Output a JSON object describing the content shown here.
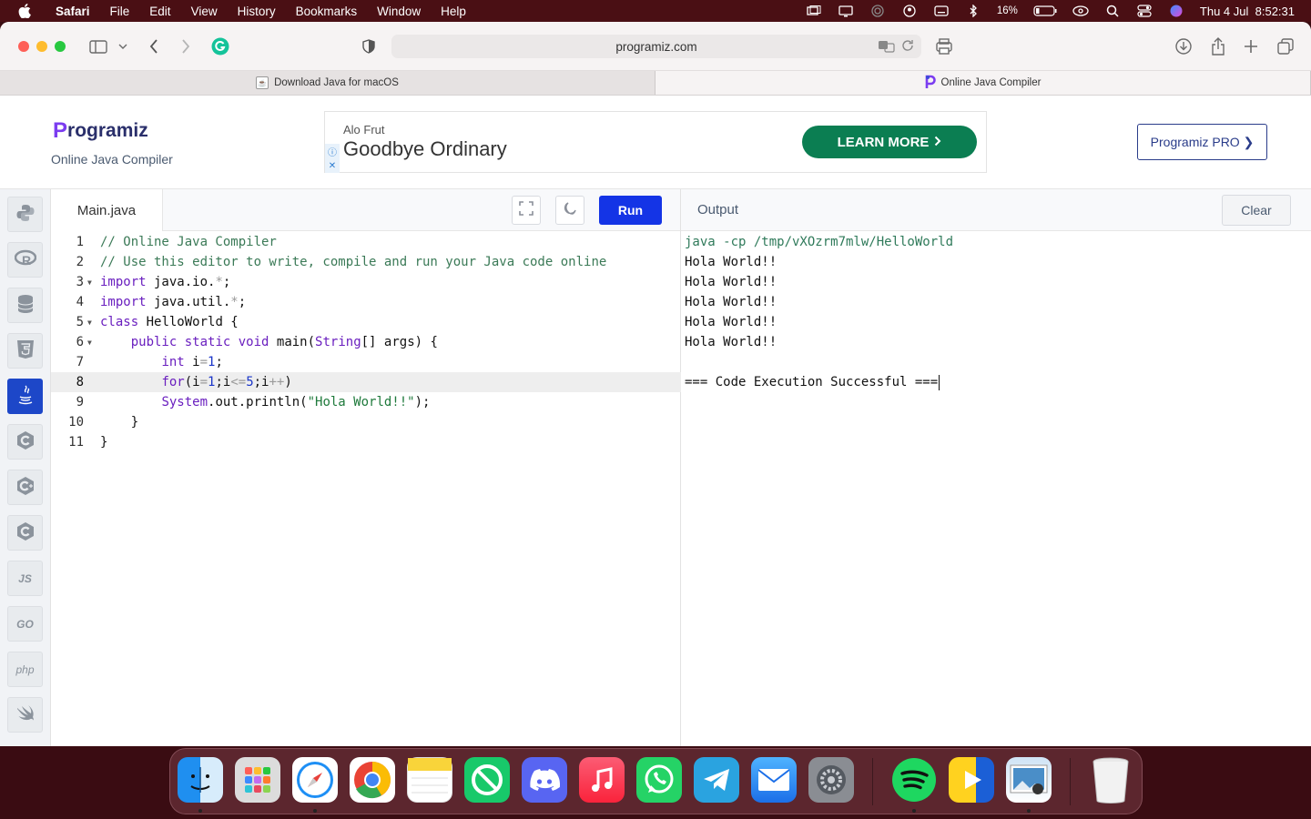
{
  "menubar": {
    "app_name": "Safari",
    "items": [
      "File",
      "Edit",
      "View",
      "History",
      "Bookmarks",
      "Window",
      "Help"
    ],
    "battery": "16%",
    "clock": "Thu 4 Jul  8:52:31"
  },
  "browser": {
    "url": "programiz.com",
    "tabs": [
      {
        "label": "Download Java for macOS",
        "active": false
      },
      {
        "label": "Online Java Compiler",
        "active": true
      }
    ]
  },
  "site": {
    "logo_text": "rogramiz",
    "logo_initial": "P",
    "subtitle": "Online Java Compiler",
    "pro_button": "Programiz PRO ❯"
  },
  "ad": {
    "brand": "Alo Frut",
    "headline": "Goodbye Ordinary",
    "cta": "LEARN MORE"
  },
  "sidebar_langs": [
    {
      "name": "python",
      "label": "Py",
      "active": false
    },
    {
      "name": "r",
      "label": "R",
      "active": false
    },
    {
      "name": "sql",
      "label": "DB",
      "active": false
    },
    {
      "name": "html",
      "label": "5",
      "active": false
    },
    {
      "name": "java",
      "label": "☕",
      "active": true
    },
    {
      "name": "c",
      "label": "C",
      "active": false
    },
    {
      "name": "cpp",
      "label": "C+",
      "active": false
    },
    {
      "name": "csharp",
      "label": "C#",
      "active": false
    },
    {
      "name": "js",
      "label": "JS",
      "active": false
    },
    {
      "name": "go",
      "label": "GO",
      "active": false
    },
    {
      "name": "php",
      "label": "php",
      "active": false
    },
    {
      "name": "swift",
      "label": "➶",
      "active": false
    }
  ],
  "editor": {
    "file_tab": "Main.java",
    "run_label": "Run",
    "lines": [
      "// Online Java Compiler",
      "// Use this editor to write, compile and run your Java code online",
      "import java.io.*;",
      "import java.util.*;",
      "class HelloWorld {",
      "    public static void main(String[] args) {",
      "        int i=1;",
      "        for(i=1;i<=5;i++)",
      "        System.out.println(\"Hola World!!\");",
      "    }",
      "}"
    ],
    "highlighted_line": 8
  },
  "output": {
    "title": "Output",
    "clear_label": "Clear",
    "lines": [
      "java -cp /tmp/vXOzrm7mlw/HelloWorld",
      "Hola World!!",
      "Hola World!!",
      "Hola World!!",
      "Hola World!!",
      "Hola World!!",
      "",
      "=== Code Execution Successful ==="
    ]
  },
  "dock": {
    "apps": [
      "Finder",
      "Launchpad",
      "Safari",
      "Chrome",
      "Notes",
      "Focus",
      "Discord",
      "Music",
      "WhatsApp",
      "Telegram",
      "Mail",
      "System Settings",
      "Spotify",
      "Infuse",
      "Preview",
      "Trash"
    ]
  }
}
